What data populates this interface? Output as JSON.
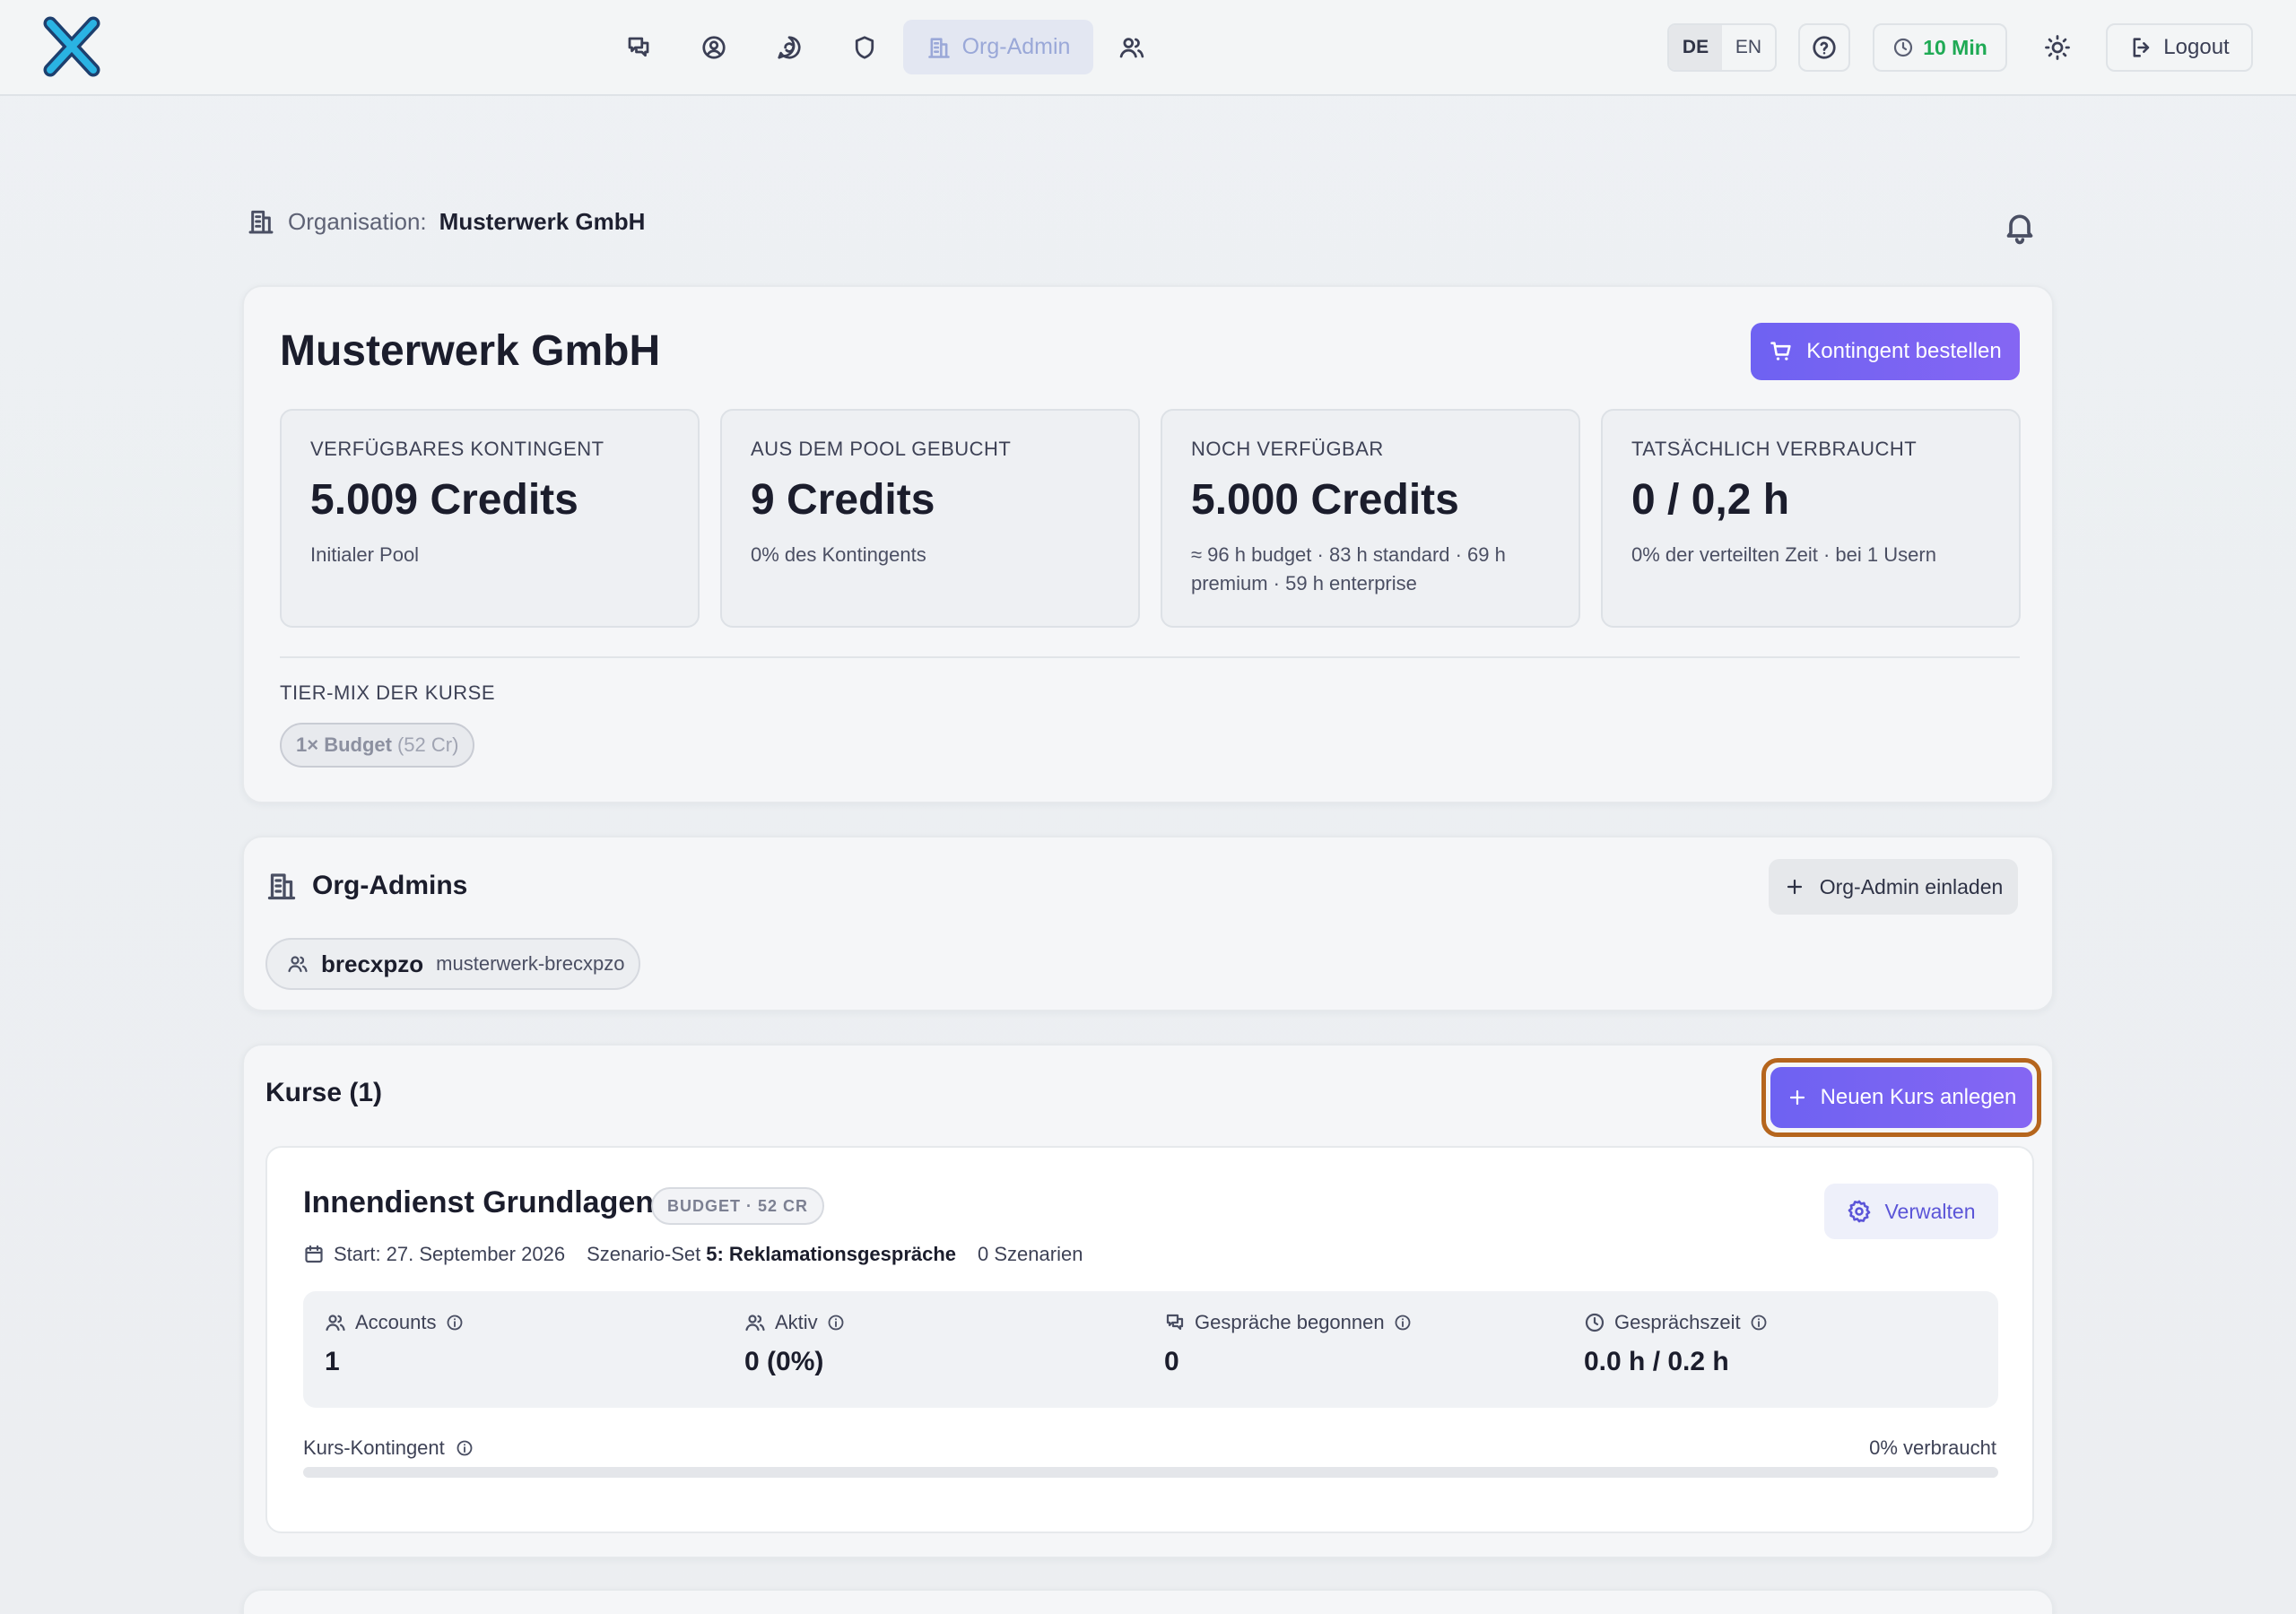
{
  "nav": {
    "active_label": "Org-Admin",
    "lang_de": "DE",
    "lang_en": "EN",
    "timer": "10 Min",
    "logout": "Logout"
  },
  "org": {
    "label": "Organisation:",
    "name": "Musterwerk GmbH"
  },
  "summary": {
    "title": "Musterwerk GmbH",
    "order_button": "Kontingent bestellen",
    "stats": [
      {
        "title": "VERFÜGBARES KONTINGENT",
        "value": "5.009 Credits",
        "sub": "Initialer Pool"
      },
      {
        "title": "AUS DEM POOL GEBUCHT",
        "value": "9 Credits",
        "sub": "0% des Kontingents"
      },
      {
        "title": "NOCH VERFÜGBAR",
        "value": "5.000 Credits",
        "sub": "≈ 96 h budget · 83 h standard · 69 h premium · 59 h enterprise"
      },
      {
        "title": "TATSÄCHLICH VERBRAUCHT",
        "value": "0 / 0,2 h",
        "sub": "0% der verteilten Zeit · bei 1 Usern"
      }
    ],
    "tiermix_label": "TIER-MIX DER KURSE",
    "tiermix_chip": "1× Budget",
    "tiermix_chip_sub": "(52 Cr)"
  },
  "admins": {
    "title": "Org-Admins",
    "invite_button": "Org-Admin einladen",
    "items": [
      {
        "name": "brecxpzo",
        "username": "musterwerk-brecxpzo"
      }
    ]
  },
  "courses": {
    "title": "Kurse (1)",
    "new_button": "Neuen Kurs anlegen",
    "items": [
      {
        "title": "Innendienst Grundlagen",
        "badge": "BUDGET · 52 CR",
        "manage": "Verwalten",
        "start": "Start: 27. September 2026",
        "scenario_set_label": "Szenario-Set",
        "scenario_set_value": "5: Reklamationsgespräche",
        "scenarios": "0 Szenarien",
        "metrics": [
          {
            "label": "Accounts",
            "value": "1"
          },
          {
            "label": "Aktiv",
            "value": "0 (0%)"
          },
          {
            "label": "Gespräche begonnen",
            "value": "0"
          },
          {
            "label": "Gesprächszeit",
            "value": "0.0 h / 0.2 h"
          }
        ],
        "quota_label": "Kurs-Kontingent",
        "quota_used": "0% verbraucht",
        "quota_fraction": 0
      }
    ]
  },
  "colors": {
    "accent": "#6e62f2",
    "timer_green": "#1faa55",
    "focus_ring": "#b5651d"
  }
}
